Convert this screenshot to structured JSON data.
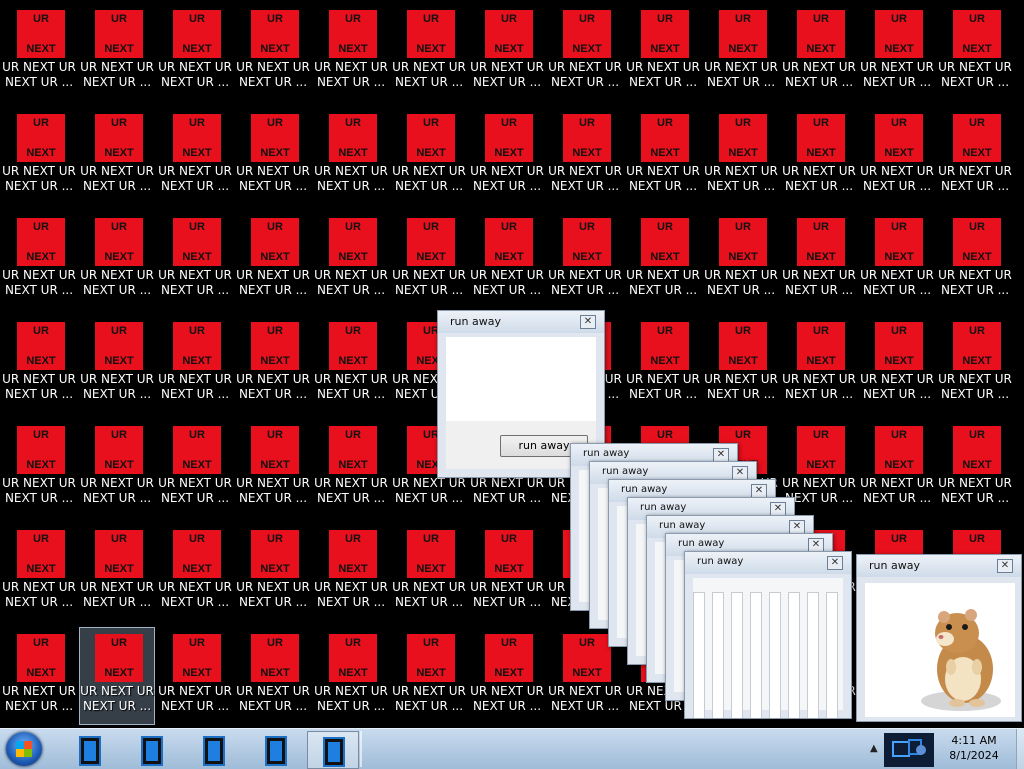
{
  "desktop": {
    "icon_title": "UR",
    "icon_subtitle": "NEXT",
    "icon_label": "UR NEXT UR\nNEXT UR ..."
  },
  "windows": {
    "run_away_dialog": {
      "title": "run away",
      "button": "run away",
      "close": "✕"
    },
    "stack_titles": [
      "run away",
      "run away",
      "run away",
      "run away",
      "run away",
      "run away",
      "run away"
    ],
    "hamster_window": {
      "title": "run away",
      "close": "✕"
    }
  },
  "taskbar": {
    "clock_time": "4:11 AM",
    "clock_date": "8/1/2024",
    "tray_arrow": "▲"
  },
  "colors": {
    "icon_red": "#e8101c",
    "desktop": "#000000",
    "taskbar": "#b7cfe6"
  }
}
